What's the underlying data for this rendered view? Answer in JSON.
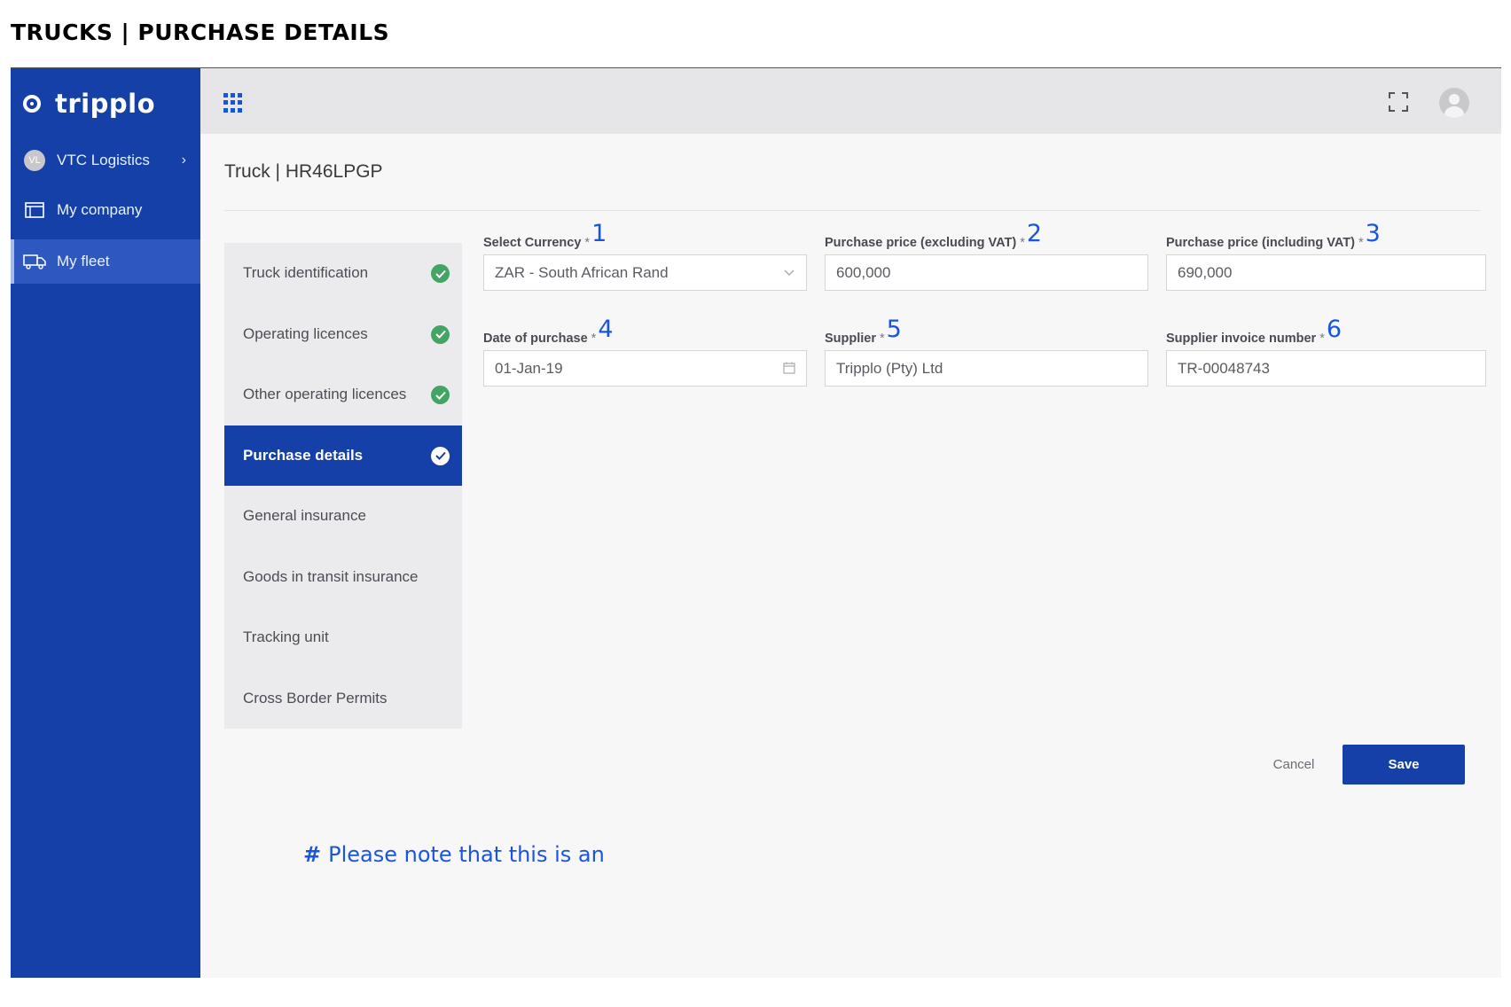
{
  "doc_title": "TRUCKS | PURCHASE DETAILS",
  "app": {
    "logo_text": "tripplo",
    "org": {
      "initials": "VL",
      "name": "VTC Logistics",
      "chevron": "›"
    },
    "sidebar": [
      {
        "label": "My company",
        "icon": "company-icon",
        "active": false
      },
      {
        "label": "My fleet",
        "icon": "truck-icon",
        "active": true
      }
    ]
  },
  "page": {
    "title": "Truck | HR46LPGP"
  },
  "steps": [
    {
      "label": "Truck identification",
      "status": "done"
    },
    {
      "label": "Operating licences",
      "status": "done"
    },
    {
      "label": "Other operating licences",
      "status": "done"
    },
    {
      "label": "Purchase details",
      "status": "active"
    },
    {
      "label": "General insurance",
      "status": ""
    },
    {
      "label": "Goods in transit insurance",
      "status": ""
    },
    {
      "label": "Tracking unit",
      "status": ""
    },
    {
      "label": "Cross Border Permits",
      "status": ""
    }
  ],
  "form": {
    "currency": {
      "label": "Select Currency",
      "required": "*",
      "marker": "1",
      "value": "ZAR - South African Rand"
    },
    "price_excl": {
      "label": "Purchase price (excluding VAT)",
      "required": "*",
      "marker": "2",
      "value": "600,000"
    },
    "price_incl": {
      "label": "Purchase price (including VAT)",
      "required": "*",
      "marker": "3",
      "value": "690,000"
    },
    "date": {
      "label": "Date of purchase",
      "required": "*",
      "marker": "4",
      "value": "01-Jan-19"
    },
    "supplier": {
      "label": "Supplier",
      "required": "*",
      "marker": "5",
      "value": "Tripplo (Pty) Ltd"
    },
    "invoice": {
      "label": "Supplier invoice number",
      "required": "*",
      "marker": "6",
      "value": "TR-00048743"
    }
  },
  "actions": {
    "cancel": "Cancel",
    "save": "Save"
  },
  "note": {
    "hash": "#",
    "text": "Please note that this is an"
  },
  "colors": {
    "brand": "#1440a8",
    "success": "#43a463",
    "annotation": "#1a55e0"
  }
}
